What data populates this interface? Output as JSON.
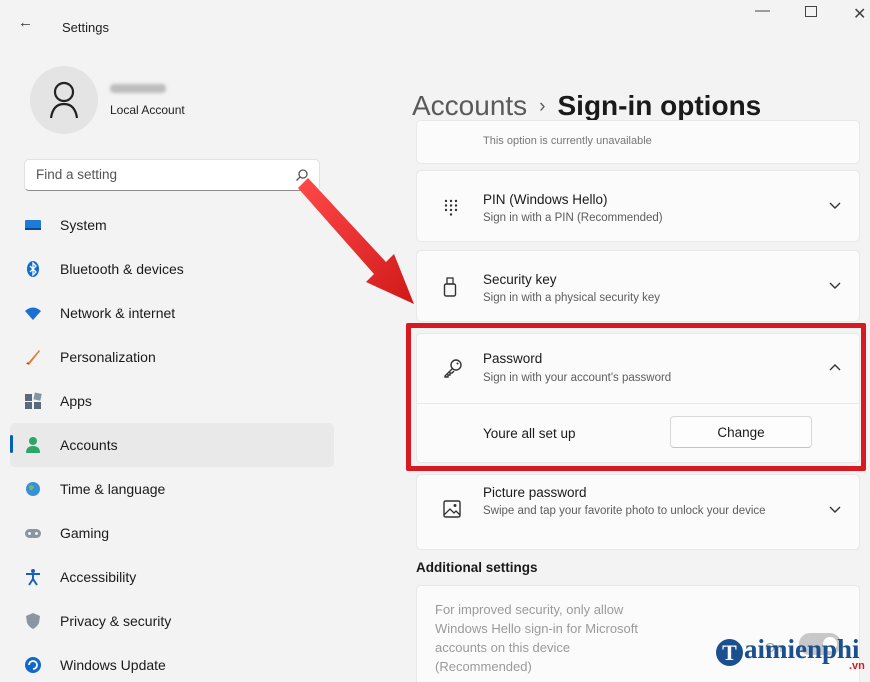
{
  "window": {
    "title": "Settings",
    "back_icon": "back-arrow-icon"
  },
  "profile": {
    "account_type": "Local Account"
  },
  "search": {
    "placeholder": "Find a setting"
  },
  "sidebar": {
    "items": [
      {
        "label": "System",
        "icon": "system-icon"
      },
      {
        "label": "Bluetooth & devices",
        "icon": "bluetooth-icon"
      },
      {
        "label": "Network & internet",
        "icon": "wifi-icon"
      },
      {
        "label": "Personalization",
        "icon": "brush-icon"
      },
      {
        "label": "Apps",
        "icon": "apps-icon"
      },
      {
        "label": "Accounts",
        "icon": "accounts-icon",
        "active": true
      },
      {
        "label": "Time & language",
        "icon": "globe-icon"
      },
      {
        "label": "Gaming",
        "icon": "gamepad-icon"
      },
      {
        "label": "Accessibility",
        "icon": "accessibility-icon"
      },
      {
        "label": "Privacy & security",
        "icon": "shield-icon"
      },
      {
        "label": "Windows Update",
        "icon": "update-icon"
      }
    ]
  },
  "breadcrumb": {
    "parent": "Accounts",
    "separator": "›",
    "current": "Sign-in options"
  },
  "options": {
    "truncated_text": "This option is currently unavailable",
    "pin": {
      "title": "PIN (Windows Hello)",
      "subtitle": "Sign in with a PIN (Recommended)"
    },
    "security_key": {
      "title": "Security key",
      "subtitle": "Sign in with a physical security key"
    },
    "password": {
      "title": "Password",
      "subtitle": "Sign in with your account's password",
      "status": "Youre all set up",
      "button": "Change"
    },
    "picture_password": {
      "title": "Picture password",
      "subtitle": "Swipe and tap your favorite photo to unlock your device"
    }
  },
  "additional": {
    "heading": "Additional settings",
    "hello_text": "For improved security, only allow Windows Hello sign-in for Microsoft accounts on this device (Recommended)",
    "toggle_label": "On",
    "toggle_state": "on"
  },
  "annotation": {
    "highlight_color": "#d71921"
  },
  "watermark": {
    "letter": "T",
    "text": "aimienphi",
    "domain": ".vn"
  }
}
